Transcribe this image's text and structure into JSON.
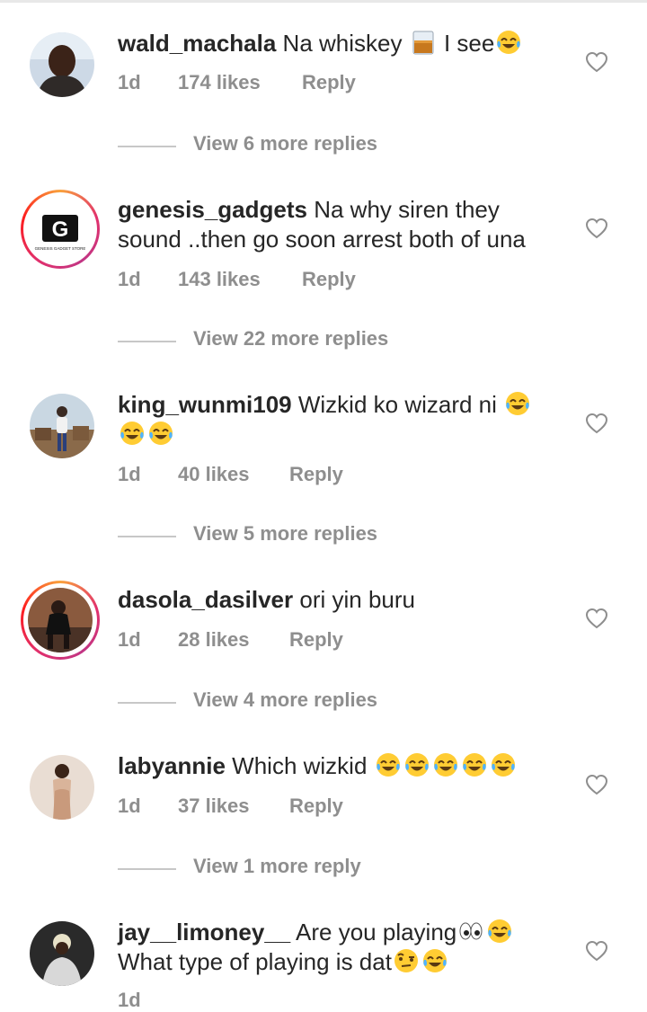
{
  "comments": [
    {
      "username": "wald_machala",
      "text": "Na whiskey",
      "text_after_emoji": "I see",
      "emojis": [
        "tumbler-glass-emoji",
        "face-with-tears-of-joy-emoji"
      ],
      "time": "1d",
      "likes": "174 likes",
      "reply_label": "Reply",
      "view_replies": "View 6 more replies"
    },
    {
      "username": "genesis_gadgets",
      "text": "Na why siren they sound ..then go soon arrest both of una",
      "emojis": [],
      "time": "1d",
      "likes": "143 likes",
      "reply_label": "Reply",
      "view_replies": "View 22 more replies",
      "avatar_logo": "G",
      "avatar_caption": "GENESIS GADGET STORE"
    },
    {
      "username": "king_wunmi109",
      "text": "Wizkid ko wizard ni",
      "emojis": [
        "face-with-tears-of-joy-emoji",
        "face-with-tears-of-joy-emoji",
        "face-with-tears-of-joy-emoji"
      ],
      "time": "1d",
      "likes": "40 likes",
      "reply_label": "Reply",
      "view_replies": "View 5 more replies"
    },
    {
      "username": "dasola_dasilver",
      "text": "ori yin buru",
      "emojis": [],
      "time": "1d",
      "likes": "28 likes",
      "reply_label": "Reply",
      "view_replies": "View 4 more replies"
    },
    {
      "username": "labyannie",
      "text": "Which wizkid",
      "emojis": [
        "face-with-tears-of-joy-emoji",
        "face-with-tears-of-joy-emoji",
        "face-with-tears-of-joy-emoji",
        "face-with-tears-of-joy-emoji",
        "face-with-tears-of-joy-emoji"
      ],
      "time": "1d",
      "likes": "37 likes",
      "reply_label": "Reply",
      "view_replies": "View 1 more reply"
    },
    {
      "username": "jay__limoney__",
      "text": "Are you playing",
      "text_line2": "What type of playing is dat",
      "emojis": [
        "eyes-emoji",
        "face-with-tears-of-joy-emoji",
        "face-with-raised-eyebrow-emoji",
        "face-with-tears-of-joy-emoji"
      ],
      "time": "1d"
    }
  ],
  "colors": {
    "text": "#262626",
    "secondary": "#8e8e8e",
    "divider": "#c7c7c7",
    "story_ring": [
      "#f9a23c",
      "#e1306c",
      "#c13584"
    ]
  },
  "icons": {
    "like": "heart-outline-icon"
  }
}
